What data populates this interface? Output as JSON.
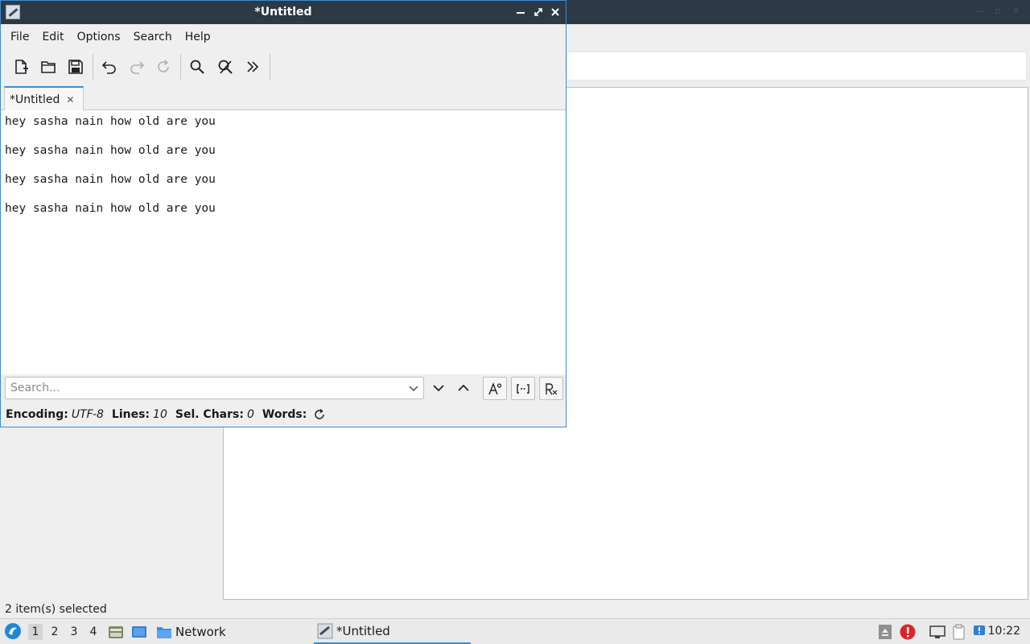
{
  "background_window": {
    "status_text": "2 item(s) selected"
  },
  "editor": {
    "title": "*Untitled",
    "menu": [
      "File",
      "Edit",
      "Options",
      "Search",
      "Help"
    ],
    "toolbar_icons": [
      "new-document-icon",
      "open-folder-icon",
      "save-icon",
      "undo-icon",
      "redo-icon",
      "reload-icon",
      "find-icon",
      "find-replace-icon",
      "more-chevrons-icon"
    ],
    "tab": {
      "label": "*Untitled",
      "close": "✕"
    },
    "lines": [
      "hey sasha nain how old are you",
      "hey sasha nain how old are you",
      "hey sasha nain how old are you",
      "hey sasha nain how old are you"
    ],
    "search": {
      "placeholder": "Search...",
      "value": ""
    },
    "status": {
      "encoding_label": "Encoding:",
      "encoding_value": "UTF-8",
      "lines_label": "Lines:",
      "lines_value": "10",
      "sel_label": "Sel. Chars:",
      "sel_value": "0",
      "words_label": "Words:"
    }
  },
  "taskbar": {
    "workspaces": [
      "1",
      "2",
      "3",
      "4"
    ],
    "network_label": "Network",
    "editor_task_label": "*Untitled",
    "clock": "10:22"
  },
  "colors": {
    "titlebar": "#2d3a46",
    "accent": "#3b8cd6",
    "alert": "#d9262c"
  }
}
